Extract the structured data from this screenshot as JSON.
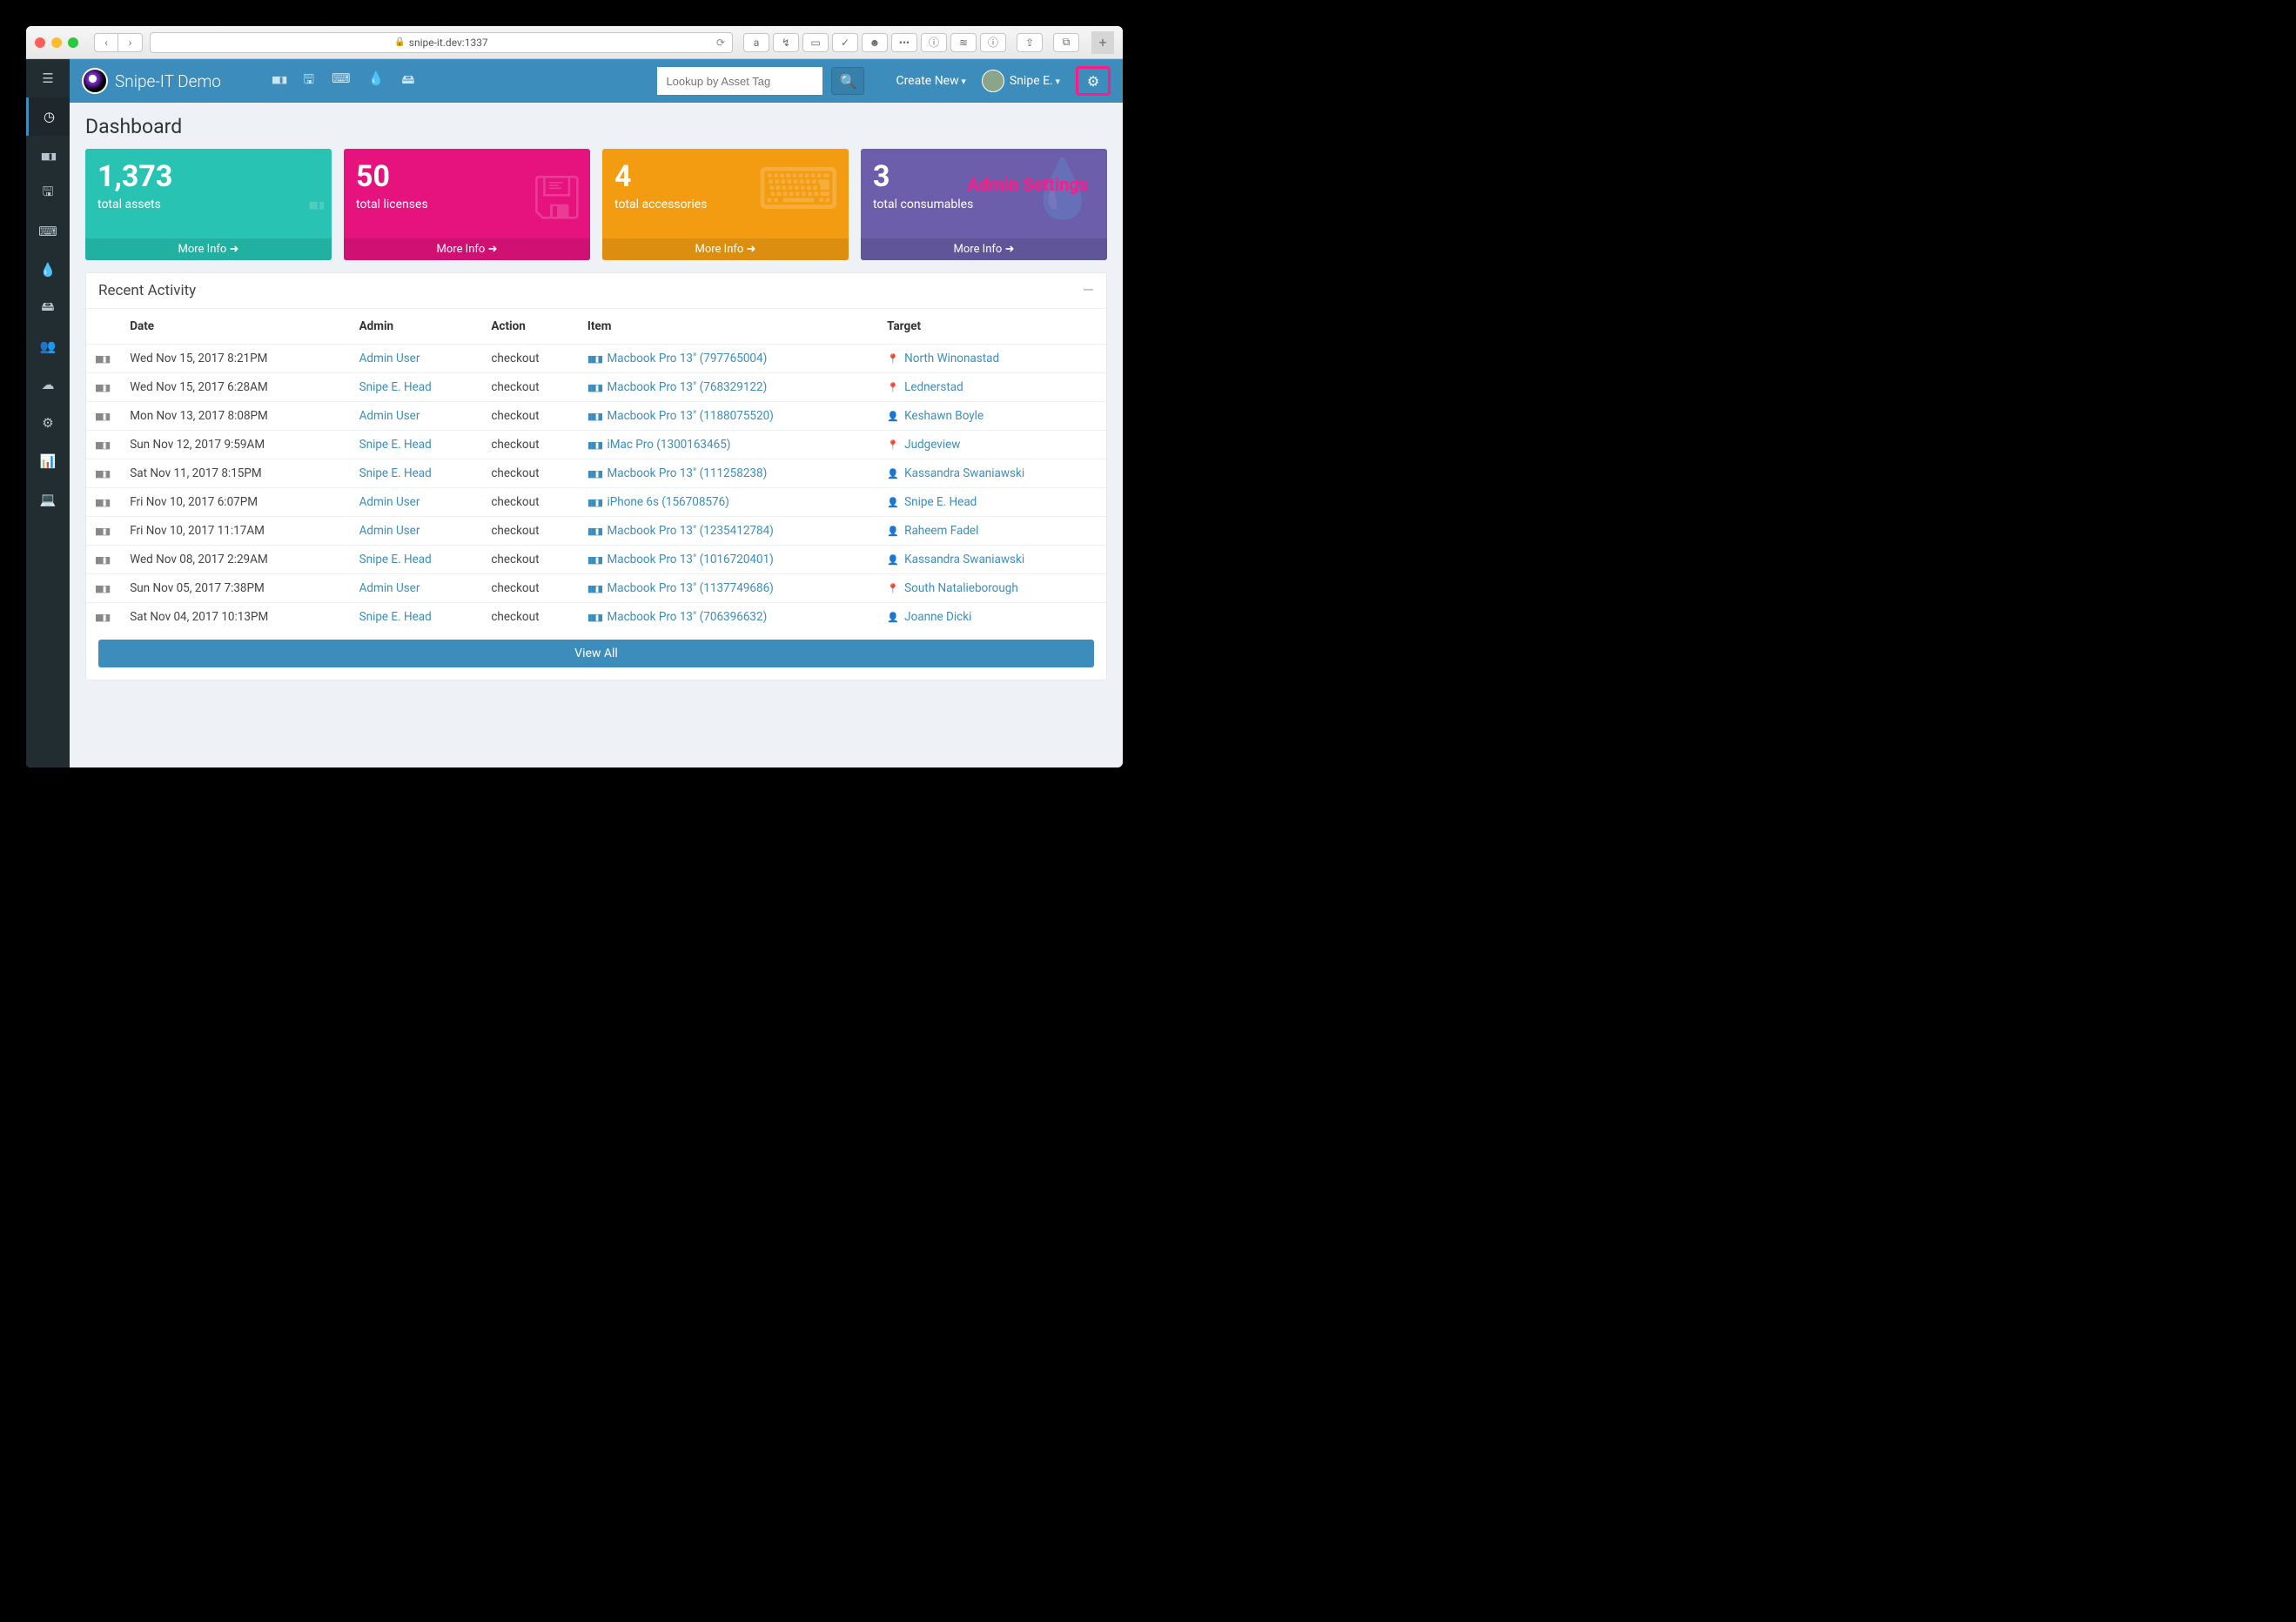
{
  "browser": {
    "url": "snipe-it.dev:1337"
  },
  "header": {
    "brand": "Snipe-IT Demo",
    "search_placeholder": "Lookup by Asset Tag",
    "create_new": "Create New",
    "user_name": "Snipe E."
  },
  "annotation": {
    "label": "Admin Settings"
  },
  "page": {
    "title": "Dashboard"
  },
  "cards": [
    {
      "value": "1,373",
      "label": "total assets",
      "more": "More Info",
      "icon": "barcode",
      "color": "c1"
    },
    {
      "value": "50",
      "label": "total licenses",
      "more": "More Info",
      "icon": "save",
      "color": "c-pink"
    },
    {
      "value": "4",
      "label": "total accessories",
      "more": "More Info",
      "icon": "keyboard",
      "color": "c-orange"
    },
    {
      "value": "3",
      "label": "total consumables",
      "more": "More Info",
      "icon": "tint",
      "color": "c-purple"
    }
  ],
  "recent": {
    "title": "Recent Activity",
    "view_all": "View All",
    "columns": {
      "date": "Date",
      "admin": "Admin",
      "action": "Action",
      "item": "Item",
      "target": "Target"
    },
    "rows": [
      {
        "date": "Wed Nov 15, 2017 8:21PM",
        "admin": "Admin User",
        "action": "checkout",
        "item": "Macbook Pro 13\" (797765004)",
        "target": "North Winonastad",
        "target_type": "location"
      },
      {
        "date": "Wed Nov 15, 2017 6:28AM",
        "admin": "Snipe E. Head",
        "action": "checkout",
        "item": "Macbook Pro 13\" (768329122)",
        "target": "Lednerstad",
        "target_type": "location"
      },
      {
        "date": "Mon Nov 13, 2017 8:08PM",
        "admin": "Admin User",
        "action": "checkout",
        "item": "Macbook Pro 13\" (1188075520)",
        "target": "Keshawn Boyle",
        "target_type": "user"
      },
      {
        "date": "Sun Nov 12, 2017 9:59AM",
        "admin": "Snipe E. Head",
        "action": "checkout",
        "item": "iMac Pro (1300163465)",
        "target": "Judgeview",
        "target_type": "location"
      },
      {
        "date": "Sat Nov 11, 2017 8:15PM",
        "admin": "Snipe E. Head",
        "action": "checkout",
        "item": "Macbook Pro 13\" (111258238)",
        "target": "Kassandra Swaniawski",
        "target_type": "user"
      },
      {
        "date": "Fri Nov 10, 2017 6:07PM",
        "admin": "Admin User",
        "action": "checkout",
        "item": "iPhone 6s (156708576)",
        "target": "Snipe E. Head",
        "target_type": "user"
      },
      {
        "date": "Fri Nov 10, 2017 11:17AM",
        "admin": "Admin User",
        "action": "checkout",
        "item": "Macbook Pro 13\" (1235412784)",
        "target": "Raheem Fadel",
        "target_type": "user"
      },
      {
        "date": "Wed Nov 08, 2017 2:29AM",
        "admin": "Snipe E. Head",
        "action": "checkout",
        "item": "Macbook Pro 13\" (1016720401)",
        "target": "Kassandra Swaniawski",
        "target_type": "user"
      },
      {
        "date": "Sun Nov 05, 2017 7:38PM",
        "admin": "Admin User",
        "action": "checkout",
        "item": "Macbook Pro 13\" (1137749686)",
        "target": "South Natalieborough",
        "target_type": "location"
      },
      {
        "date": "Sat Nov 04, 2017 10:13PM",
        "admin": "Snipe E. Head",
        "action": "checkout",
        "item": "Macbook Pro 13\" (706396632)",
        "target": "Joanne Dicki",
        "target_type": "user"
      }
    ]
  }
}
